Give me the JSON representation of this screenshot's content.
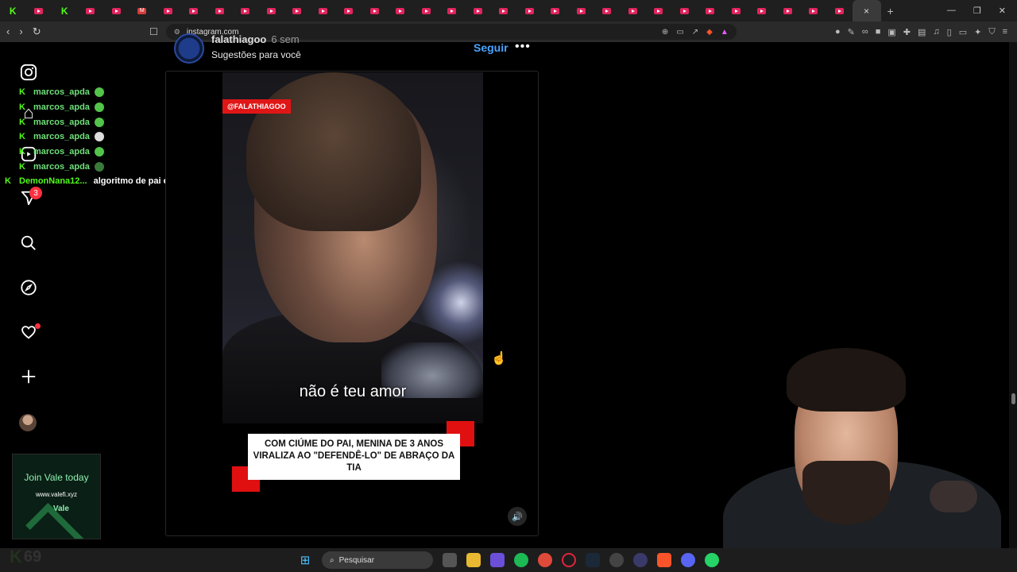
{
  "browser": {
    "url": "instagram.com",
    "new_tab": "+",
    "close_tab": "×"
  },
  "sidebar": {
    "notifications_badge": "3"
  },
  "chat": {
    "messages": [
      {
        "user": "marcos_apda"
      },
      {
        "user": "marcos_apda"
      },
      {
        "user": "marcos_apda"
      },
      {
        "user": "marcos_apda"
      },
      {
        "user": "marcos_apda"
      },
      {
        "user": "marcos_apda"
      }
    ],
    "highlight": {
      "user": "DemonNana12...",
      "text": "algoritmo de pai e mae zé"
    }
  },
  "post": {
    "username": "falathiagoo",
    "age": "6 sem",
    "subtitle": "Sugestões para você",
    "follow_label": "Seguir",
    "more_label": "•••",
    "tag": "@FALATHIAGOO",
    "video_subtitle": "não é teu amor",
    "caption": "COM CIÚME DO PAI, MENINA DE 3 ANOS VIRALIZA AO \"DEFENDÊ-LO\" DE ABRAÇO DA TIA"
  },
  "ad": {
    "headline": "Join Vale today",
    "site": "www.valefi.xyz",
    "brand": "Vale"
  },
  "overlay": {
    "kick_count": "69"
  },
  "taskbar": {
    "search_label": "Pesquisar"
  }
}
